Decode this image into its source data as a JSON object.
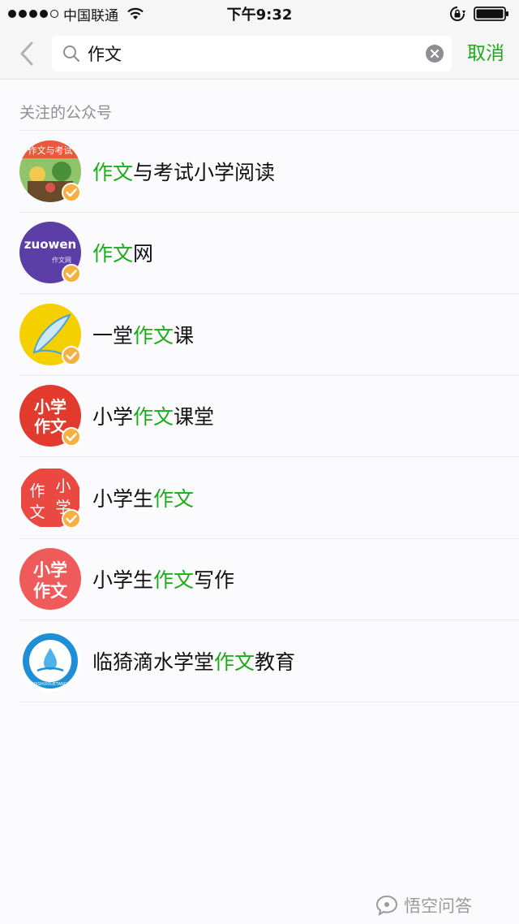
{
  "status_bar": {
    "carrier": "中国联通",
    "time": "下午9:32"
  },
  "search": {
    "value": "作文",
    "cancel_label": "取消"
  },
  "section": {
    "title": "关注的公众号"
  },
  "results": [
    {
      "pre": "",
      "hl": "作文",
      "post": "与考试小学阅读",
      "verified": true,
      "avatar_text": "作文与考试"
    },
    {
      "pre": "",
      "hl": "作文",
      "post": "网",
      "verified": true,
      "avatar_text": "zuowen",
      "avatar_sub": "作文网"
    },
    {
      "pre": "一堂",
      "hl": "作文",
      "post": "课",
      "verified": true
    },
    {
      "pre": "小学",
      "hl": "作文",
      "post": "课堂",
      "verified": true,
      "avatar_text_1": "小学",
      "avatar_text_2": "作文"
    },
    {
      "pre": "小学生",
      "hl": "作文",
      "post": "",
      "verified": true,
      "avatar_text_1": "作",
      "avatar_text_2": "文",
      "avatar_text_3": "小",
      "avatar_text_4": "学"
    },
    {
      "pre": "小学生",
      "hl": "作文",
      "post": "写作",
      "verified": false,
      "avatar_text_1": "小学",
      "avatar_text_2": "作文"
    },
    {
      "pre": "临猗滴水学堂",
      "hl": "作文",
      "post": "教育",
      "verified": false,
      "avatar_text": "DISHUIXUETANG"
    }
  ],
  "watermark": {
    "text": "悟空问答"
  },
  "colors": {
    "accent": "#1aad19",
    "badge": "#f5b041"
  }
}
